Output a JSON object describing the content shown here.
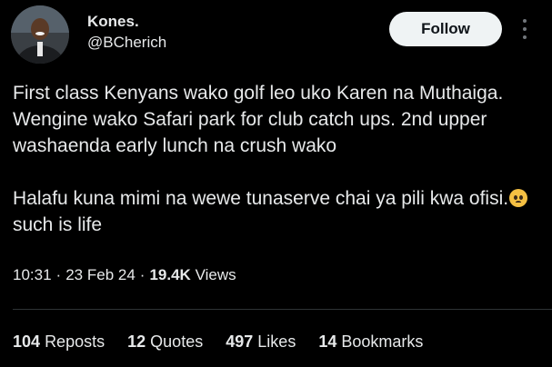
{
  "author": {
    "name": "Kones.",
    "handle": "@BCherich",
    "follow_label": "Follow"
  },
  "tweet": {
    "paragraph1": "First class Kenyans wako golf leo uko Karen na Muthaiga. Wengine wako Safari park for club catch ups. 2nd upper washaenda early lunch na crush wako",
    "paragraph2_part1": "Halafu kuna mimi na wewe tunaserve chai ya pili kwa ofisi.",
    "paragraph2_part2": "such is life"
  },
  "meta": {
    "time": "10:31",
    "date": "23 Feb 24",
    "views_count": "19.4K",
    "views_label": "Views"
  },
  "stats": [
    {
      "count": "104",
      "label": "Reposts"
    },
    {
      "count": "12",
      "label": "Quotes"
    },
    {
      "count": "497",
      "label": "Likes"
    },
    {
      "count": "14",
      "label": "Bookmarks"
    }
  ],
  "colors": {
    "background": "#000000",
    "text": "#e7e9ea",
    "follow_button": "#eff3f4",
    "divider": "#2f3336"
  },
  "icons": {
    "more": "more-vertical-icon",
    "emoji": "pleading-face-emoji"
  }
}
